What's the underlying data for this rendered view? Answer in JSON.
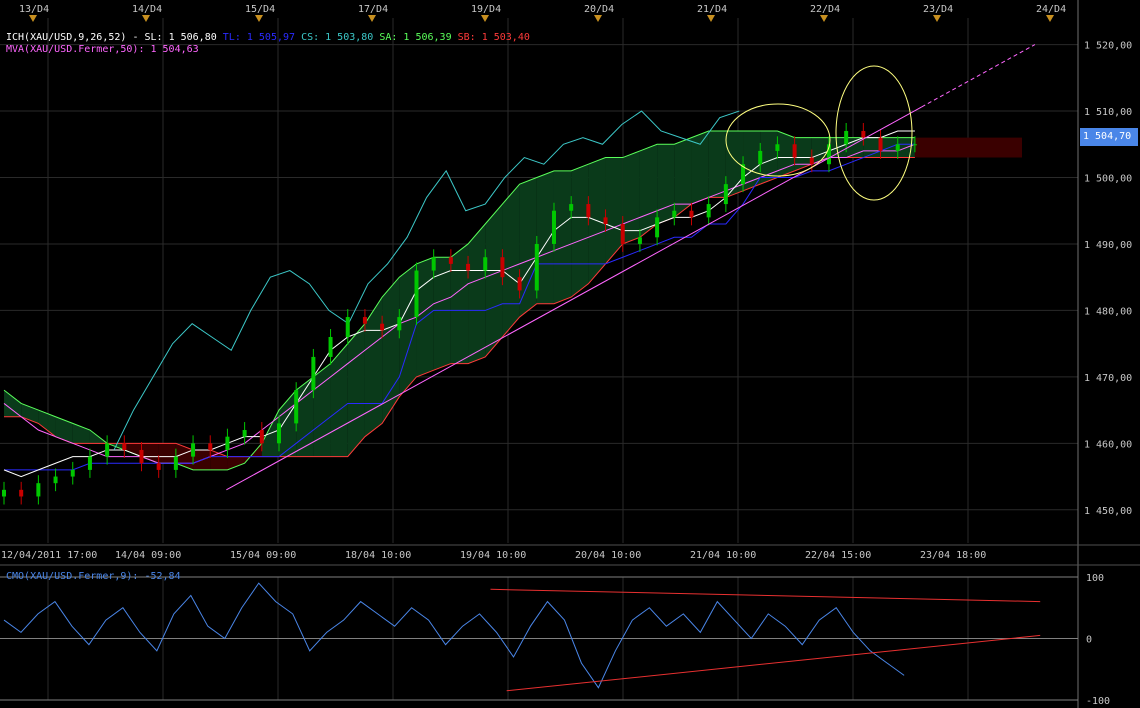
{
  "main_legend": {
    "ichimoku": "ICH(XAU/USD,9,26,52)",
    "sl": "SL: 1 506,80",
    "tl": "TL: 1 505,97",
    "cs": "CS: 1 503,80",
    "sa": "SA: 1 506,39",
    "sb": "SB: 1 503,40",
    "mva": "MVA(XAU/USD.Fermer,50): 1 504,63"
  },
  "current_price_label": "1 504,70",
  "cmo_legend": "CMO(XAU/USD.Fermer,9): -52,84",
  "colors": {
    "candle_up": "#00c800",
    "candle_down": "#c80000",
    "tenkan": "#ffffff",
    "kijun": "#2a2aff",
    "chikou": "#3cc8c8",
    "senkou_a": "#5aff5a",
    "senkou_b": "#ff3a3a",
    "mva": "#ff66ff",
    "cloud_bull": "#0a3a1a",
    "cloud_bear": "#3a0000",
    "cmo_line": "#4a86e8",
    "trendline": "#e83030",
    "grid": "#2a2a2a",
    "annotation": "#ffff80",
    "price_tag_bg": "#4a86e8"
  },
  "top_markers": [
    "13/D4",
    "14/D4",
    "15/D4",
    "17/D4",
    "19/D4",
    "20/D4",
    "21/D4",
    "22/D4",
    "23/D4",
    "24/D4"
  ],
  "chart_data": [
    {
      "type": "line",
      "ylabel": "",
      "ylim": [
        1445,
        1524
      ],
      "y_ticks": [
        1450,
        1460,
        1470,
        1480,
        1490,
        1500,
        1510,
        1520
      ],
      "y_tick_labels": [
        "1 450,00",
        "1 460,00",
        "1 470,00",
        "1 480,00",
        "1 490,00",
        "1 500,00",
        "1 510,00",
        "1 520,00"
      ],
      "x_tick_labels": [
        "12/04/2011 17:00",
        "14/04 09:00",
        "15/04 09:00",
        "18/04 10:00",
        "19/04 10:00",
        "20/04 10:00",
        "21/04 10:00",
        "22/04 15:00",
        "23/04 18:00"
      ],
      "grid": true,
      "series": [
        {
          "id": "close",
          "values": [
            1453,
            1452,
            1454,
            1455,
            1456,
            1458,
            1460,
            1459,
            1457,
            1456,
            1458,
            1460,
            1459,
            1461,
            1462,
            1460,
            1463,
            1468,
            1473,
            1476,
            1479,
            1478,
            1477,
            1479,
            1486,
            1488,
            1487,
            1486,
            1488,
            1485,
            1483,
            1490,
            1495,
            1496,
            1494,
            1493,
            1490,
            1491,
            1494,
            1495,
            1494,
            1496,
            1499,
            1502,
            1504,
            1505,
            1503,
            1502,
            1505,
            1507,
            1506,
            1504,
            1505,
            1505
          ]
        },
        {
          "id": "tenkan",
          "values": [
            1456,
            1455,
            1456,
            1457,
            1458,
            1458,
            1459,
            1459,
            1458,
            1458,
            1458,
            1459,
            1459,
            1460,
            1461,
            1461,
            1462,
            1466,
            1470,
            1474,
            1476,
            1477,
            1477,
            1478,
            1483,
            1485,
            1486,
            1486,
            1486,
            1486,
            1484,
            1488,
            1492,
            1494,
            1494,
            1493,
            1492,
            1492,
            1493,
            1494,
            1494,
            1495,
            1497,
            1500,
            1502,
            1503,
            1503,
            1503,
            1504,
            1505,
            1506,
            1506,
            1507,
            1507
          ]
        },
        {
          "id": "kijun",
          "values": [
            1456,
            1456,
            1456,
            1456,
            1456,
            1457,
            1457,
            1457,
            1457,
            1457,
            1457,
            1457,
            1458,
            1458,
            1458,
            1458,
            1458,
            1460,
            1462,
            1464,
            1466,
            1466,
            1466,
            1470,
            1478,
            1480,
            1480,
            1480,
            1480,
            1481,
            1481,
            1487,
            1487,
            1487,
            1487,
            1487,
            1488,
            1489,
            1490,
            1491,
            1491,
            1493,
            1493,
            1496,
            1500,
            1500,
            1500,
            1501,
            1501,
            1502,
            1503,
            1504,
            1505,
            1505
          ]
        },
        {
          "id": "chikou",
          "values": [
            1459,
            1465,
            1470,
            1475,
            1478,
            1476,
            1474,
            1480,
            1485,
            1486,
            1484,
            1480,
            1478,
            1484,
            1487,
            1491,
            1497,
            1501,
            1495,
            1496,
            1500,
            1503,
            1502,
            1505,
            1506,
            1505,
            1508,
            1510,
            1507,
            1506,
            1505,
            1509,
            1510
          ]
        },
        {
          "id": "senkou_a",
          "values": [
            1468,
            1466,
            1465,
            1464,
            1463,
            1462,
            1460,
            1459,
            1458,
            1457,
            1457,
            1456,
            1456,
            1456,
            1457,
            1460,
            1465,
            1468,
            1470,
            1472,
            1475,
            1478,
            1482,
            1485,
            1487,
            1488,
            1488,
            1490,
            1493,
            1496,
            1499,
            1500,
            1501,
            1501,
            1502,
            1503,
            1503,
            1504,
            1505,
            1505,
            1506,
            1507,
            1507,
            1507,
            1507,
            1507,
            1506,
            1506,
            1506,
            1506,
            1506,
            1506,
            1506,
            1506
          ]
        },
        {
          "id": "senkou_b",
          "values": [
            1464,
            1464,
            1463,
            1461,
            1460,
            1460,
            1460,
            1460,
            1460,
            1460,
            1460,
            1459,
            1459,
            1458,
            1458,
            1458,
            1458,
            1458,
            1458,
            1458,
            1458,
            1461,
            1463,
            1467,
            1470,
            1471,
            1472,
            1472,
            1473,
            1476,
            1479,
            1481,
            1481,
            1482,
            1484,
            1487,
            1490,
            1491,
            1493,
            1494,
            1496,
            1497,
            1497,
            1498,
            1499,
            1500,
            1501,
            1502,
            1503,
            1503,
            1503,
            1503,
            1503,
            1503
          ]
        },
        {
          "id": "mva",
          "values": [
            1466,
            1464,
            1462,
            1461,
            1460,
            1459,
            1458,
            1458,
            1458,
            1457,
            1457,
            1457,
            1458,
            1459,
            1460,
            1462,
            1464,
            1466,
            1468,
            1470,
            1472,
            1474,
            1476,
            1478,
            1479,
            1481,
            1482,
            1484,
            1485,
            1486,
            1487,
            1488,
            1489,
            1490,
            1491,
            1492,
            1493,
            1494,
            1495,
            1496,
            1496,
            1497,
            1498,
            1499,
            1500,
            1501,
            1502,
            1502,
            1503,
            1503,
            1504,
            1504,
            1504,
            1505
          ]
        }
      ],
      "candles_close": [
        1453,
        1452,
        1454,
        1455,
        1456,
        1458,
        1460,
        1459,
        1457,
        1456,
        1458,
        1460,
        1459,
        1461,
        1462,
        1460,
        1463,
        1468,
        1473,
        1476,
        1479,
        1478,
        1477,
        1479,
        1486,
        1488,
        1487,
        1486,
        1488,
        1485,
        1483,
        1490,
        1495,
        1496,
        1494,
        1493,
        1490,
        1491,
        1494,
        1495,
        1494,
        1496,
        1499,
        1502,
        1504,
        1505,
        1503,
        1502,
        1505,
        1507,
        1506,
        1504,
        1505,
        1505
      ],
      "trendline": {
        "from": [
          0.21,
          1453
        ],
        "to": [
          0.96,
          1520
        ]
      }
    },
    {
      "type": "line",
      "ylim": [
        -100,
        100
      ],
      "y_tick_labels": [
        "100",
        "0",
        "-100"
      ],
      "series": [
        {
          "id": "cmo",
          "values": [
            30,
            10,
            40,
            60,
            20,
            -10,
            30,
            50,
            10,
            -20,
            40,
            70,
            20,
            0,
            50,
            90,
            60,
            40,
            -20,
            10,
            30,
            60,
            40,
            20,
            50,
            30,
            -10,
            20,
            40,
            10,
            -30,
            20,
            60,
            30,
            -40,
            -80,
            -20,
            30,
            50,
            20,
            40,
            10,
            60,
            30,
            0,
            40,
            20,
            -10,
            30,
            50,
            10,
            -20,
            -40,
            -60
          ]
        },
        {
          "id": "upper_trend",
          "from": [
            0.455,
            80
          ],
          "to": [
            0.9,
            60
          ]
        },
        {
          "id": "lower_trend",
          "from": [
            0.47,
            -85
          ],
          "to": [
            0.9,
            5
          ]
        }
      ]
    }
  ]
}
